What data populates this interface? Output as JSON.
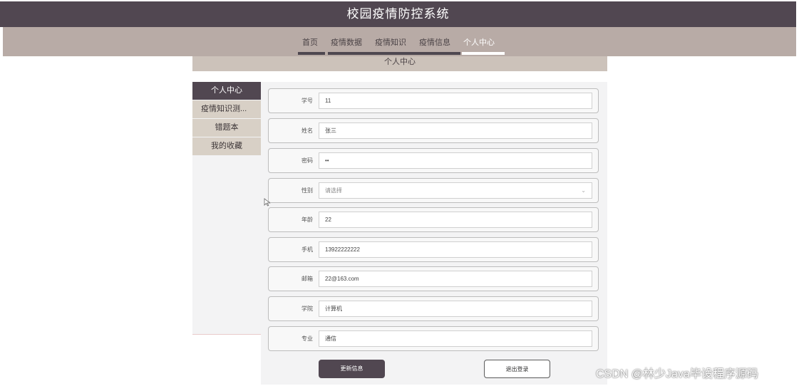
{
  "app": {
    "title": "校园疫情防控系统"
  },
  "nav": {
    "items": [
      {
        "label": "首页",
        "active": false
      },
      {
        "label": "疫情数据",
        "active": false
      },
      {
        "label": "疫情知识",
        "active": false
      },
      {
        "label": "疫情信息",
        "active": false
      },
      {
        "label": "个人中心",
        "active": true
      }
    ]
  },
  "page": {
    "title": "个人中心"
  },
  "sidebar": {
    "items": [
      {
        "label": "个人中心",
        "active": true
      },
      {
        "label": "疫情知识测...",
        "active": false
      },
      {
        "label": "错题本",
        "active": false
      },
      {
        "label": "我的收藏",
        "active": false
      }
    ]
  },
  "form": {
    "fields": [
      {
        "label": "学号",
        "value": "11"
      },
      {
        "label": "姓名",
        "value": "张三"
      },
      {
        "label": "密码",
        "value": "••"
      },
      {
        "label": "性别",
        "value": "请选择",
        "type": "select"
      },
      {
        "label": "年龄",
        "value": "22"
      },
      {
        "label": "手机",
        "value": "13922222222"
      },
      {
        "label": "邮箱",
        "value": "22@163.com"
      },
      {
        "label": "学院",
        "value": "计算机"
      },
      {
        "label": "专业",
        "value": "通信"
      }
    ],
    "update_label": "更新信息",
    "logout_label": "退出登录"
  },
  "watermark": {
    "text": "CSDN @林少Java毕设程序源码"
  },
  "colors": {
    "title_bar": "#514751",
    "nav_bar": "#b8aba6",
    "sidebar_active": "#514751",
    "sidebar_item": "#d8d0c6",
    "page_title_bar": "#ccc2ba"
  }
}
